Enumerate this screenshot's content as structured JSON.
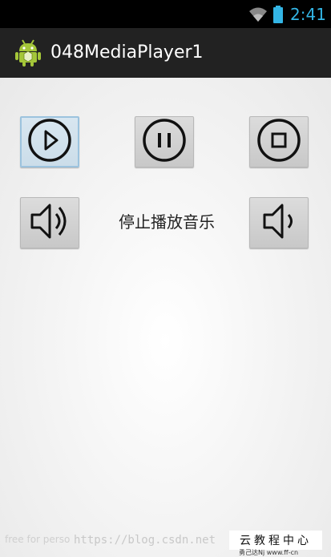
{
  "status_bar": {
    "time": "2:41",
    "icons": [
      "wifi-icon",
      "battery-icon"
    ],
    "accent_color": "#33b5e5"
  },
  "action_bar": {
    "app_icon": "android-icon",
    "title": "048MediaPlayer1",
    "background": "#222222"
  },
  "controls": {
    "row1": [
      {
        "icon": "play-icon",
        "state": "focused"
      },
      {
        "icon": "pause-icon"
      },
      {
        "icon": "stop-icon"
      }
    ],
    "row2_left": {
      "icon": "volume-up-icon"
    },
    "row2_right": {
      "icon": "volume-down-icon"
    },
    "status_text": "停止播放音乐"
  },
  "watermarks": {
    "left": "free for perso",
    "url": "https://blog.csdn.net",
    "box": "云教程中心",
    "foot": "勇己达Nj   www.ff-cn"
  }
}
